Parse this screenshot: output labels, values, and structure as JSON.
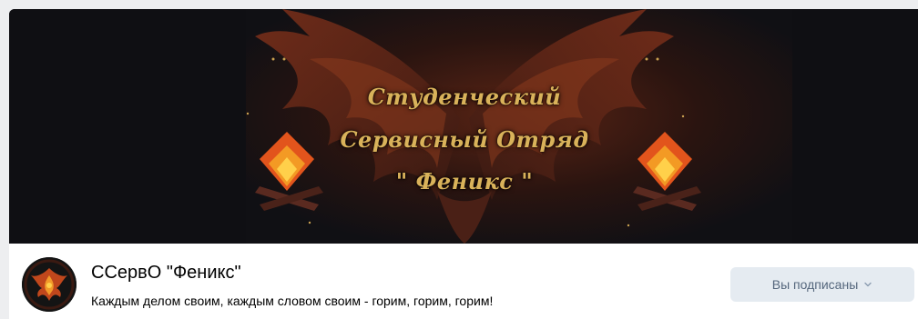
{
  "cover": {
    "line1": "Студенческий",
    "line2": "Сервисный Отряд",
    "line3": "\" Феникс \""
  },
  "group": {
    "name": "ССервО \"Феникс\"",
    "status": "Каждым делом своим, каждым словом своим - горим, горим, горим!"
  },
  "subscribe": {
    "label": "Вы подписаны",
    "icon": "chevron-down-icon"
  },
  "colors": {
    "cover_bg": "#101014",
    "cover_text": "#d9b25a",
    "button_bg": "#e5ebf1",
    "button_text": "#55677d",
    "page_bg": "#edeef0"
  }
}
